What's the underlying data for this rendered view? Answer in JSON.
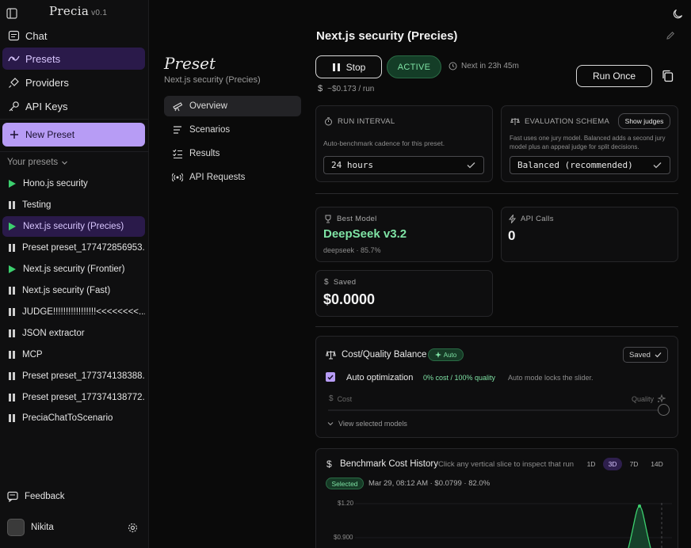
{
  "app": {
    "name": "Precia",
    "version": "v0.1"
  },
  "sidebar": {
    "nav": [
      {
        "label": "Chat",
        "icon": "chat-icon"
      },
      {
        "label": "Presets",
        "icon": "presets-icon"
      },
      {
        "label": "Providers",
        "icon": "plug-icon"
      },
      {
        "label": "API Keys",
        "icon": "key-icon"
      }
    ],
    "new_preset": "New Preset",
    "your_presets": "Your presets",
    "presets": [
      {
        "label": "Hono.js security",
        "state": "running"
      },
      {
        "label": "Testing",
        "state": "paused"
      },
      {
        "label": "Next.js security (Precies)",
        "state": "running"
      },
      {
        "label": "Preset preset_177472856953...",
        "state": "paused"
      },
      {
        "label": "Next.js security (Frontier)",
        "state": "running"
      },
      {
        "label": "Next.js security (Fast)",
        "state": "paused"
      },
      {
        "label": "JUDGE!!!!!!!!!!!!!!!!!<<<<<<<<...",
        "state": "paused"
      },
      {
        "label": "JSON extractor",
        "state": "paused"
      },
      {
        "label": "MCP",
        "state": "paused"
      },
      {
        "label": "Preset preset_177374138388...",
        "state": "paused"
      },
      {
        "label": "Preset preset_177374138772...",
        "state": "paused"
      },
      {
        "label": "PreciaChatToScenario",
        "state": "paused"
      }
    ],
    "feedback": "Feedback",
    "user": "Nikita"
  },
  "preset_panel": {
    "title": "Preset",
    "subtitle": "Next.js security (Precies)",
    "nav": [
      {
        "label": "Overview",
        "icon": "telescope-icon"
      },
      {
        "label": "Scenarios",
        "icon": "list-icon"
      },
      {
        "label": "Results",
        "icon": "checklist-icon"
      },
      {
        "label": "API Requests",
        "icon": "broadcast-icon"
      }
    ]
  },
  "main": {
    "title": "Next.js security (Precies)",
    "stop_label": "Stop",
    "status": "ACTIVE",
    "next_in": "Next in 23h 45m",
    "run_once": "Run Once",
    "cost_per_run": "~$0.173 / run",
    "run_interval": {
      "label": "RUN INTERVAL",
      "desc": "Auto-benchmark cadence for this preset.",
      "value": "24 hours"
    },
    "evaluation_schema": {
      "label": "EVALUATION SCHEMA",
      "show_judges": "Show judges",
      "desc": "Fast uses one jury model. Balanced adds a second jury model plus an appeal judge for split decisions.",
      "value": "Balanced (recommended)"
    },
    "best_model": {
      "label": "Best Model",
      "name": "DeepSeek v3.2",
      "sub": "deepseek · 85.7%"
    },
    "api_calls": {
      "label": "API Calls",
      "value": "0"
    },
    "saved": {
      "label": "Saved",
      "value": "$0.0000"
    },
    "cost_quality": {
      "title": "Cost/Quality Balance",
      "auto_badge": "Auto",
      "saved_label": "Saved",
      "auto_opt": "Auto optimization",
      "ratio": "0% cost / 100% quality",
      "note": "Auto mode locks the slider.",
      "cost_label": "Cost",
      "quality_label": "Quality",
      "view_models": "View selected models",
      "quality_weight": 1.0
    },
    "history": {
      "title": "Benchmark Cost History",
      "hint": "Click any vertical slice to inspect that run",
      "ranges": [
        "1D",
        "3D",
        "7D",
        "14D"
      ],
      "active_range": "3D",
      "selected_badge": "Selected",
      "selected_info": "Mar 29, 08:12 AM · $0.0799 · 82.0%",
      "y_ticks": [
        "$1.20",
        "$0.900"
      ]
    }
  },
  "colors": {
    "accent": "#b79cf5",
    "success": "#3ccf6e",
    "success_text": "#7fe3a5",
    "bg": "#0a0a0a"
  }
}
